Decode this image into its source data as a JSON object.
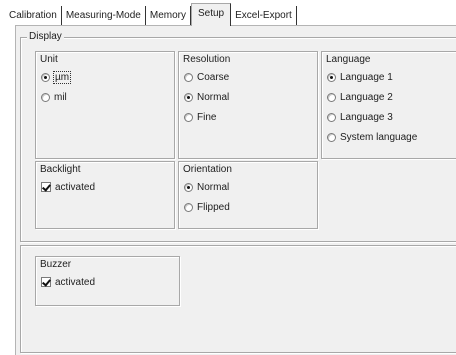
{
  "tabs": [
    {
      "label": "Calibration",
      "active": false
    },
    {
      "label": "Measuring-Mode",
      "active": false
    },
    {
      "label": "Memory",
      "active": false
    },
    {
      "label": "Setup",
      "active": true
    },
    {
      "label": "Excel-Export",
      "active": false
    }
  ],
  "display": {
    "title": "Display",
    "unit": {
      "title": "Unit",
      "options": [
        {
          "label": "µm",
          "selected": true
        },
        {
          "label": "mil",
          "selected": false
        }
      ]
    },
    "resolution": {
      "title": "Resolution",
      "options": [
        {
          "label": "Coarse",
          "selected": false
        },
        {
          "label": "Normal",
          "selected": true
        },
        {
          "label": "Fine",
          "selected": false
        }
      ]
    },
    "language": {
      "title": "Language",
      "options": [
        {
          "label": "Language 1",
          "selected": true
        },
        {
          "label": "Language 2",
          "selected": false
        },
        {
          "label": "Language 3",
          "selected": false
        },
        {
          "label": "System language",
          "selected": false
        }
      ]
    },
    "backlight": {
      "title": "Backlight",
      "checkbox": {
        "label": "activated",
        "checked": true
      }
    },
    "orientation": {
      "title": "Orientation",
      "options": [
        {
          "label": "Normal",
          "selected": true
        },
        {
          "label": "Flipped",
          "selected": false
        }
      ]
    }
  },
  "buzzer": {
    "title": "Buzzer",
    "checkbox": {
      "label": "activated",
      "checked": true
    }
  }
}
